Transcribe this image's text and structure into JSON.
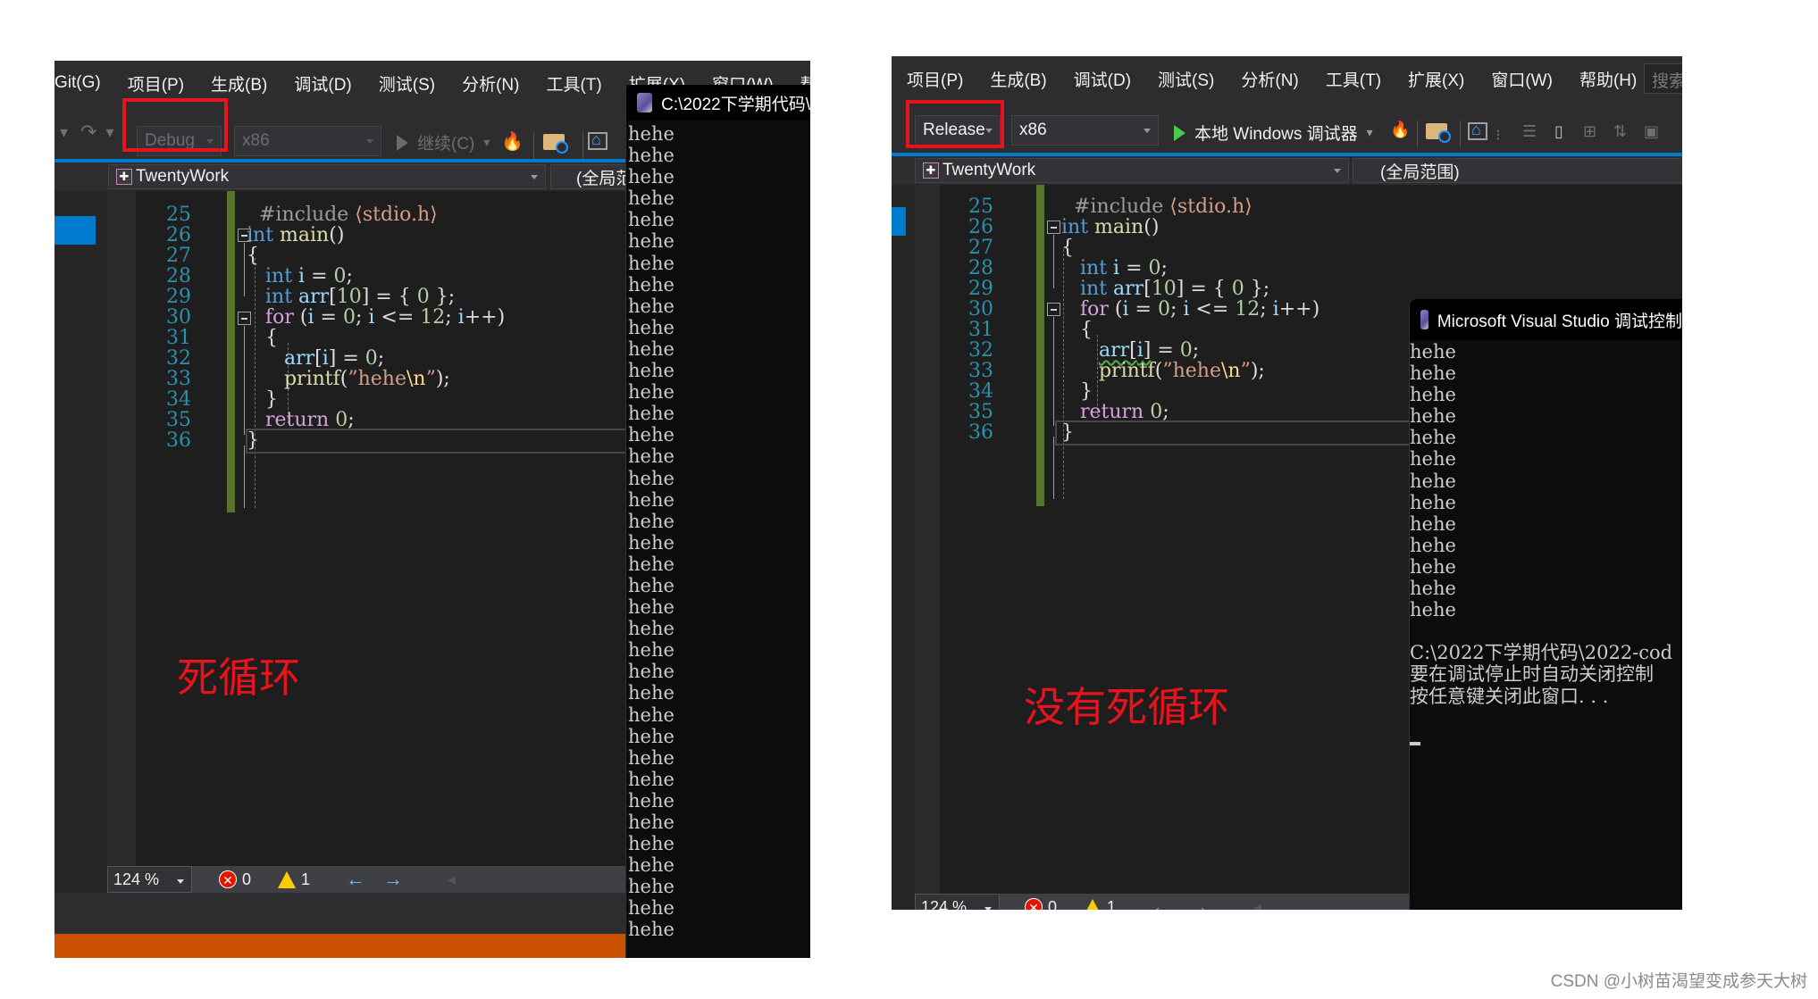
{
  "left_panel": {
    "menu": [
      "Git(G)",
      "项目(P)",
      "生成(B)",
      "调试(D)",
      "测试(S)",
      "分析(N)",
      "工具(T)",
      "扩展(X)",
      "窗口(W)",
      "帮助"
    ],
    "toolbar": {
      "configuration": "Debug",
      "platform": "x86",
      "continue_label": "继续(C)"
    },
    "file_tab": {
      "project": "TwentyWork",
      "scope": "(全局范围)"
    },
    "code": {
      "line_numbers": [
        "25",
        "26",
        "27",
        "28",
        "29",
        "30",
        "31",
        "32",
        "33",
        "34",
        "35",
        "36"
      ]
    },
    "status": {
      "zoom": "124 %",
      "errors": "0",
      "warnings": "1"
    },
    "annotation": "死循环",
    "console": {
      "title": "C:\\2022下学期代码\\",
      "output_line": "hehe",
      "output_count": 38
    }
  },
  "right_panel": {
    "menu": [
      "项目(P)",
      "生成(B)",
      "调试(D)",
      "测试(S)",
      "分析(N)",
      "工具(T)",
      "扩展(X)",
      "窗口(W)",
      "帮助(H)"
    ],
    "search_placeholder": "搜索",
    "toolbar": {
      "configuration": "Release",
      "platform": "x86",
      "run_label": "本地 Windows 调试器"
    },
    "file_tab": {
      "project": "TwentyWork",
      "scope": "(全局范围)"
    },
    "code": {
      "line_numbers": [
        "25",
        "26",
        "27",
        "28",
        "29",
        "30",
        "31",
        "32",
        "33",
        "34",
        "35",
        "36"
      ]
    },
    "status": {
      "zoom": "124 %",
      "errors": "0",
      "warnings": "1"
    },
    "annotation": "没有死循环",
    "console": {
      "title": "Microsoft Visual Studio 调试控制",
      "output_line": "hehe",
      "output_count": 13,
      "footer_lines": [
        "C:\\2022下学期代码\\2022-cod",
        "要在调试停止时自动关闭控制",
        "按任意键关闭此窗口. . ."
      ]
    }
  },
  "source_code": [
    "#include <stdio.h>",
    "int main()",
    "{",
    "    int i = 0;",
    "    int arr[10] = { 0 };",
    "    for (i = 0; i <= 12; i++)",
    "    {",
    "        arr[i] = 0;",
    "        printf(\"hehe\\n\");",
    "    }",
    "    return 0;",
    "}"
  ],
  "watermark": "CSDN @小树苗渴望变成参天大树",
  "colors": {
    "highlight_box": "#e8141d",
    "accent_blue": "#007acc",
    "status_orange": "#ca5100"
  }
}
